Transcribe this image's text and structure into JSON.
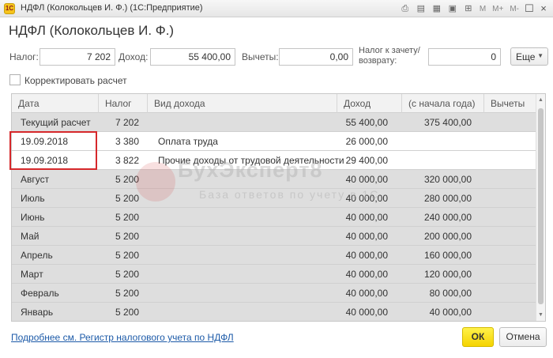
{
  "window": {
    "title": "НДФЛ (Колокольцев И. Ф.)  (1С:Предприятие)",
    "tools": {
      "m": "M",
      "m_plus": "M+",
      "m_minus": "M-"
    }
  },
  "heading": "НДФЛ (Колокольцев И. Ф.)",
  "fields": {
    "tax_label": "Налог:",
    "tax_value": "7 202",
    "income_label": "Доход:",
    "income_value": "55 400,00",
    "deductions_label": "Вычеты:",
    "deductions_value": "0,00",
    "offset_label": "Налог к зачету/возврату:",
    "offset_value": "0",
    "more_label": "Еще"
  },
  "checkbox": {
    "label": "Корректировать расчет",
    "checked": false
  },
  "table": {
    "columns": [
      "Дата",
      "Налог",
      "Вид дохода",
      "Доход",
      "(с начала года)",
      "Вычеты"
    ],
    "rows": [
      {
        "date": "Текущий расчет",
        "tax": "7 202",
        "type": "",
        "income": "55 400,00",
        "ytd": "375 400,00",
        "deductions": "",
        "style": "gray"
      },
      {
        "date": "19.09.2018",
        "tax": "3 380",
        "type": "Оплата труда",
        "income": "26 000,00",
        "ytd": "",
        "deductions": "",
        "style": "white"
      },
      {
        "date": "19.09.2018",
        "tax": "3 822",
        "type": "Прочие доходы от трудовой деятельности",
        "income": "29 400,00",
        "ytd": "",
        "deductions": "",
        "style": "white"
      },
      {
        "date": "Август",
        "tax": "5 200",
        "type": "",
        "income": "40 000,00",
        "ytd": "320 000,00",
        "deductions": "",
        "style": "gray"
      },
      {
        "date": "Июль",
        "tax": "5 200",
        "type": "",
        "income": "40 000,00",
        "ytd": "280 000,00",
        "deductions": "",
        "style": "gray"
      },
      {
        "date": "Июнь",
        "tax": "5 200",
        "type": "",
        "income": "40 000,00",
        "ytd": "240 000,00",
        "deductions": "",
        "style": "gray"
      },
      {
        "date": "Май",
        "tax": "5 200",
        "type": "",
        "income": "40 000,00",
        "ytd": "200 000,00",
        "deductions": "",
        "style": "gray"
      },
      {
        "date": "Апрель",
        "tax": "5 200",
        "type": "",
        "income": "40 000,00",
        "ytd": "160 000,00",
        "deductions": "",
        "style": "gray"
      },
      {
        "date": "Март",
        "tax": "5 200",
        "type": "",
        "income": "40 000,00",
        "ytd": "120 000,00",
        "deductions": "",
        "style": "gray"
      },
      {
        "date": "Февраль",
        "tax": "5 200",
        "type": "",
        "income": "40 000,00",
        "ytd": "80 000,00",
        "deductions": "",
        "style": "gray"
      },
      {
        "date": "Январь",
        "tax": "5 200",
        "type": "",
        "income": "40 000,00",
        "ytd": "40 000,00",
        "deductions": "",
        "style": "gray"
      }
    ]
  },
  "watermark": {
    "title": "БухЭксперт8",
    "subtitle": "База ответов по учету в 1С"
  },
  "footer": {
    "link": "Подробнее см. Регистр налогового учета по НДФЛ",
    "ok": "ОК",
    "cancel": "Отмена"
  },
  "colors": {
    "highlight": "#d6282b",
    "ok_button": "#f5d300",
    "link": "#1c5aa8",
    "row_gray": "#dedede"
  }
}
